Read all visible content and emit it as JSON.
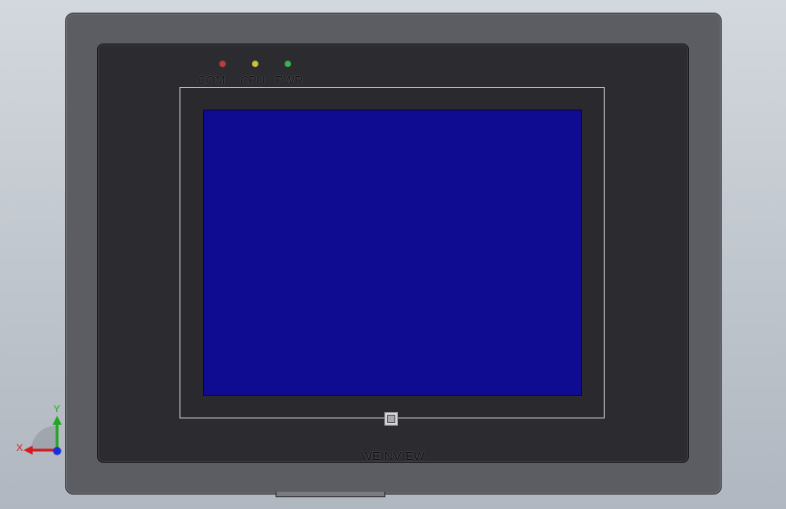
{
  "device": {
    "brand": "WEINVIEW",
    "indicators": [
      {
        "label": "COM",
        "color": "#c0393b"
      },
      {
        "label": "CPU",
        "color": "#c9c23a"
      },
      {
        "label": "PWR",
        "color": "#3ab34a"
      }
    ],
    "screen_color": "#100c92"
  },
  "axis_triad": {
    "x_label": "X",
    "y_label": "Y"
  }
}
